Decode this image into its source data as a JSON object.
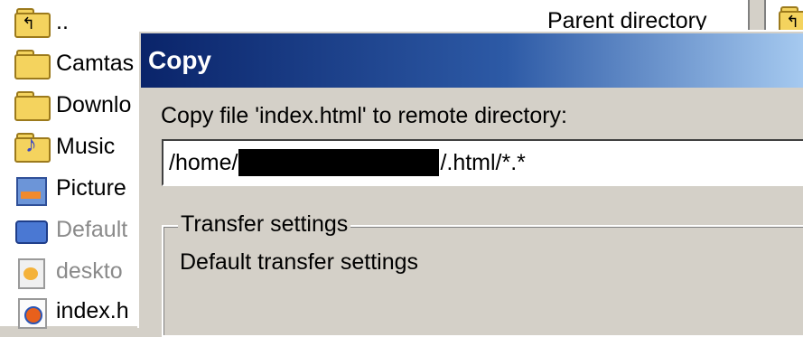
{
  "file_list": {
    "parent_label": "Parent directory",
    "items": [
      {
        "name": "..",
        "icon": "parent-folder-icon"
      },
      {
        "name": "Camtas",
        "icon": "folder-icon"
      },
      {
        "name": "Downlo",
        "icon": "folder-icon"
      },
      {
        "name": "Music",
        "icon": "music-folder-icon"
      },
      {
        "name": "Picture",
        "icon": "pictures-folder-icon"
      },
      {
        "name": "Default",
        "icon": "network-icon"
      },
      {
        "name": "deskto",
        "icon": "settings-file-icon"
      },
      {
        "name": "index.h",
        "icon": "firefox-html-icon"
      }
    ]
  },
  "dialog": {
    "title": "Copy",
    "prompt": "Copy file 'index.html' to remote directory:",
    "path_prefix": "/home/",
    "path_suffix": "/.html/*.*",
    "transfer_settings_label": "Transfer settings",
    "transfer_settings_value": "Default transfer settings"
  },
  "colors": {
    "title_gradient_start": "#0a246a",
    "title_gradient_end": "#a6caf0",
    "dialog_bg": "#d4d0c8"
  }
}
